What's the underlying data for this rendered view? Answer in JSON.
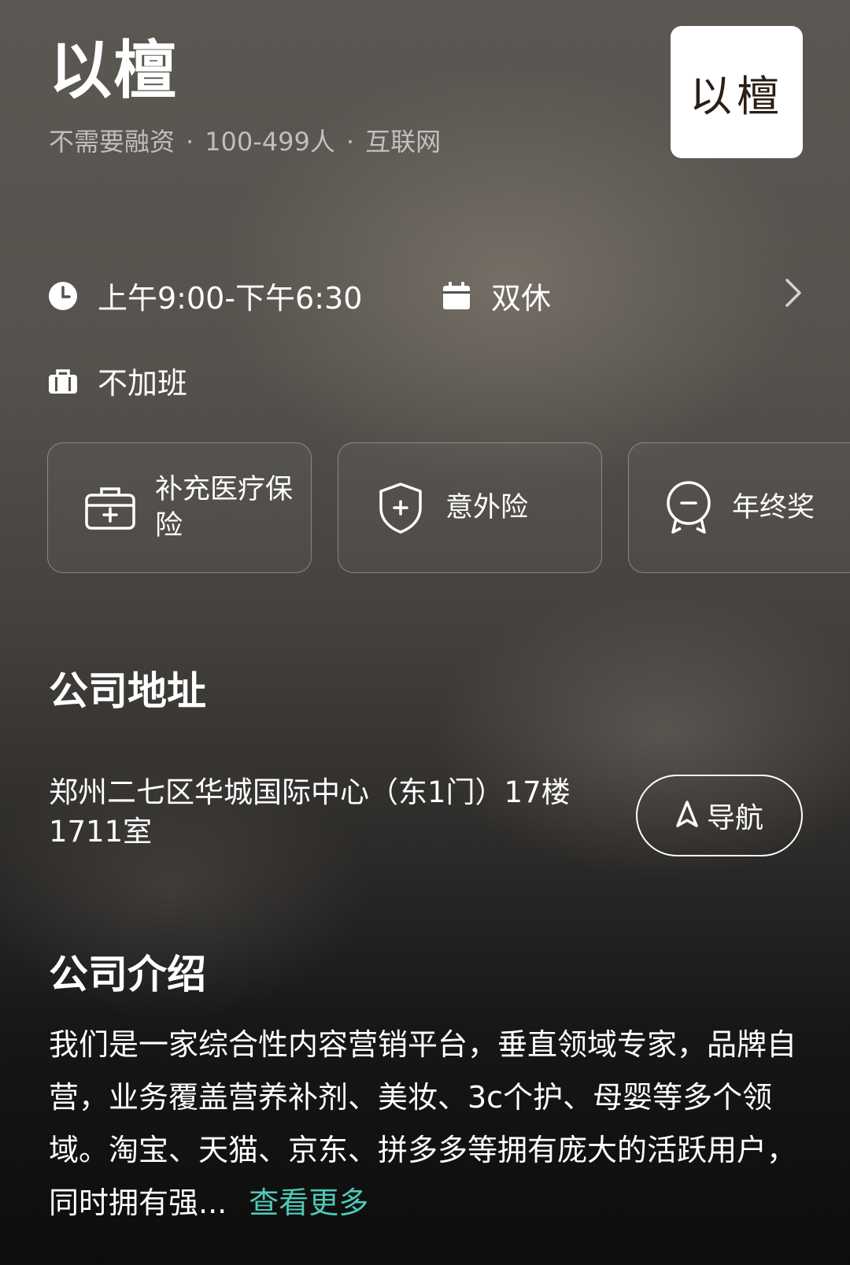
{
  "company": {
    "name": "以檀",
    "funding": "不需要融资",
    "size": "100-499人",
    "industry": "互联网",
    "separator": "·",
    "logo_text": "以檀"
  },
  "work": {
    "hours": "上午9:00-下午6:30",
    "schedule": "双休",
    "overtime": "不加班",
    "icons": [
      "clock-icon",
      "calendar-icon",
      "briefcase-icon",
      "chevron-right-icon"
    ]
  },
  "benefits": [
    {
      "label": "补充医疗保险",
      "icon": "medical-kit-icon"
    },
    {
      "label": "意外险",
      "icon": "shield-plus-icon"
    },
    {
      "label": "年终奖",
      "icon": "medal-icon"
    }
  ],
  "address": {
    "title": "公司地址",
    "text": "郑州二七区华城国际中心（东1门）17楼1711室",
    "nav_label": "导航"
  },
  "intro": {
    "title": "公司介绍",
    "text": "我们是一家综合性内容营销平台，垂直领域专家，品牌自营，业务覆盖营养补剂、美妆、3c个护、母婴等多个领域。淘宝、天猫、京东、拼多多等拥有庞大的活跃用户，同时拥有强...",
    "more": "查看更多"
  },
  "colors": {
    "link": "#4fc7b8",
    "text": "#ffffff",
    "muted": "#a8a49f"
  }
}
